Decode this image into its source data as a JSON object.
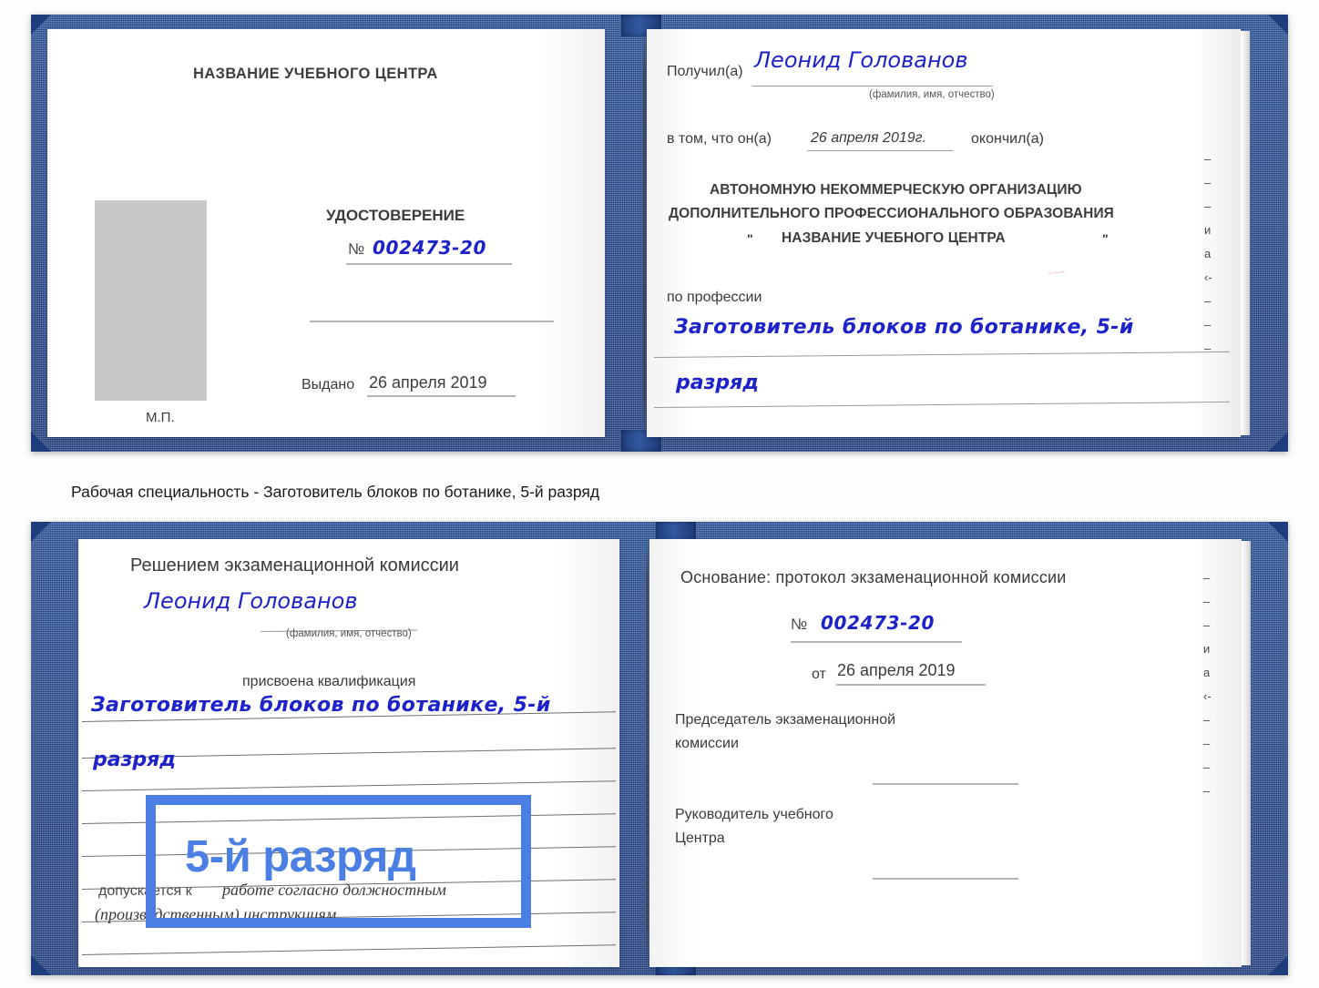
{
  "caption": "Рабочая специальность - Заготовитель блоков по ботанике, 5-й разряд",
  "certificate_top": {
    "left_page": {
      "header": "НАЗВАНИЕ УЧЕБНОГО ЦЕНТРА",
      "doc_title": "УДОСТОВЕРЕНИЕ",
      "number_symbol": "№",
      "number_value": "002473-20",
      "issued_label": "Выдано",
      "issued_date": "26 апреля 2019",
      "seal_label": "М.П.",
      "photo_placeholder": "photo-placeholder"
    },
    "right_page": {
      "received_label": "Получил(а)",
      "received_name": "Леонид Голованов",
      "name_hint": "(фамилия, имя, отчество)",
      "in_that_label": "в том, что он(а)",
      "completion_date": "26 апреля 2019г.",
      "finished_label": "окончил(а)",
      "org_line1": "АВТОНОМНУЮ НЕКОММЕРЧЕСКУЮ ОРГАНИЗАЦИЮ",
      "org_line2": "ДОПОЛНИТЕЛЬНОГО ПРОФЕССИОНАЛЬНОГО ОБРАЗОВАНИЯ",
      "org_quote_open": "\"",
      "org_name": "НАЗВАНИЕ УЧЕБНОГО ЦЕНТРА",
      "org_quote_close": "\"",
      "profession_label": "по профессии",
      "profession_line1": "Заготовитель блоков по ботанике, 5-й",
      "profession_line2": "разряд",
      "margin_fragments": [
        "–",
        "–",
        "–",
        "и",
        "а",
        "‹-",
        "–",
        "–",
        "–"
      ]
    }
  },
  "certificate_bottom": {
    "left_page": {
      "decision_title": "Решением экзаменационной комиссии",
      "name": "Леонид Голованов",
      "name_hint": "(фамилия, имя, отчество)",
      "qualification_label": "присвоена квалификация",
      "qualification_line1": "Заготовитель блоков по ботанике, 5-й",
      "qualification_line2": "разряд",
      "admitted_label": "допускается к",
      "admitted_value_line1": "работе согласно должностным",
      "admitted_value_line2": "(производственным) инструкциям",
      "highlight_word": "5-й разряд",
      "highlight_color": "#4c7fe4"
    },
    "right_page": {
      "basis_label": "Основание: протокол экзаменационной комиссии",
      "number_symbol": "№",
      "number_value": "002473-20",
      "from_label": "от",
      "from_date": "26 апреля 2019",
      "chairman_line1": "Председатель экзаменационной",
      "chairman_line2": "комиссии",
      "head_line1": "Руководитель учебного",
      "head_line2": "Центра",
      "margin_fragments": [
        "–",
        "–",
        "–",
        "и",
        "а",
        "‹-",
        "–",
        "–",
        "–",
        "–"
      ]
    }
  },
  "colors": {
    "cover_blue": "#2b4f97",
    "highlight_blue": "#4c7fe4",
    "ink_blue": "#1d23c8",
    "photo_gray": "#c8c8c8"
  }
}
